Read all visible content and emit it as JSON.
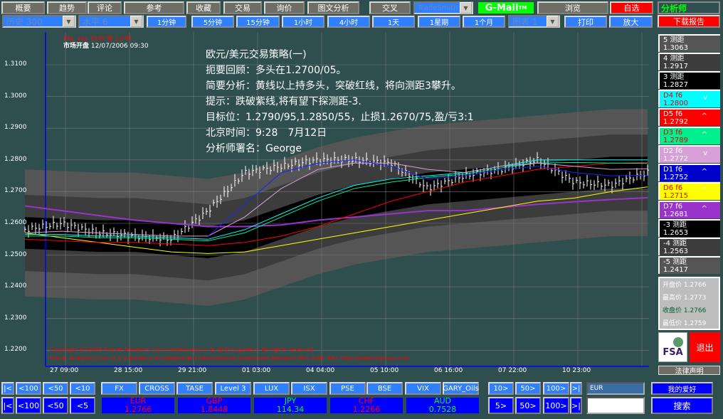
{
  "topbar": [
    "概要",
    "趋势",
    "评论",
    "参考",
    "收藏",
    "交易",
    "询价",
    "图文分析",
    "交叉"
  ],
  "tradesmith": "TradeSmith",
  "gmail": "G-Mail",
  "gmail_tm": "TM",
  "browse": "浏览",
  "custom": "自选",
  "analyst": "分析师",
  "history_select": "历史 300",
  "level_select": "水平 6",
  "periods": [
    "1分钟",
    "5分钟",
    "15分钟",
    "1小时",
    "4小时",
    "1天",
    "1星期",
    "1个月"
  ],
  "chart_select": "图表 1",
  "print": "打印",
  "zoom": "放大",
  "download": "下载报告",
  "chart_header": {
    "title": "PAL_Hu: EUR 线 1小时",
    "open_label": "市场开盘",
    "open_time": "12/07/2006 09:30"
  },
  "overlay": [
    "欧元/美元交易策略(一)",
    "扼要回顾：多头在1.2700/05。",
    "简要分析：黄线以上持多头，突破红线，将向测距3攀升。",
    "提示：跌破紫线,将有望下探测距-3.",
    "目标位：1.2790/95,1.2850/55，止损1.2670/75,盈/亏3:1",
    "北京时间：9:28　7月12日",
    "分析师署名：George"
  ],
  "copyright": [
    "Copyright (C)2003 Fronet Analytics.com Limited and or its data suppliers.  All rights reserved.",
    "Frone: Analytics.com is a subsidiary of Independent International Investment Research PLC (LSE: IIR), http://www.iirgroup.com"
  ],
  "levels": [
    {
      "label": "5 测距",
      "value": "1.3063",
      "bg": "#555555",
      "fg": "#ffffff",
      "chev": ""
    },
    {
      "label": "4 测距",
      "value": "1.2917",
      "bg": "#3c3c3c",
      "fg": "#ffffff",
      "chev": ""
    },
    {
      "label": "3 测距",
      "value": "1.2827",
      "bg": "#000000",
      "fg": "#ffffff",
      "chev": ""
    },
    {
      "label": "D4  f6",
      "value": "1.2800",
      "bg": "#00ffff",
      "fg": "#e00000",
      "chev": "v"
    },
    {
      "label": "D5  f6",
      "value": "1.2792",
      "bg": "#ff0000",
      "fg": "#ffffff",
      "chev": "^"
    },
    {
      "label": "D3  f6",
      "value": "1.2789",
      "bg": "#00f090",
      "fg": "#e00000",
      "chev": "^"
    },
    {
      "label": "D2  f6",
      "value": "1.2772",
      "bg": "#d8a0d8",
      "fg": "#ffffff",
      "chev": "v"
    },
    {
      "label": "D1  f6",
      "value": "1.2752",
      "bg": "#0000cc",
      "fg": "#ffffff",
      "chev": "^"
    },
    {
      "label": "D6  f6",
      "value": "1.2715",
      "bg": "#ffff00",
      "fg": "#e00000",
      "chev": "^"
    },
    {
      "label": "D7  f6",
      "value": "1.2681",
      "bg": "#9933cc",
      "fg": "#ffffff",
      "chev": "^"
    },
    {
      "label": "-3 测距",
      "value": "1.2653",
      "bg": "#000000",
      "fg": "#ffffff",
      "chev": ""
    },
    {
      "label": "-4 测距",
      "value": "1.2563",
      "bg": "#3c3c3c",
      "fg": "#ffffff",
      "chev": ""
    },
    {
      "label": "-5 测距",
      "value": "1.2417",
      "bg": "#555555",
      "fg": "#ffffff",
      "chev": ""
    }
  ],
  "ohlc": [
    {
      "label": "开盘价 1.2766",
      "color": "#ffffff"
    },
    {
      "label": "最高价 1.2773",
      "color": "#ffffff"
    },
    {
      "label": "收盘价 1.2766",
      "color": "#006030"
    },
    {
      "label": "最低价 1.2759",
      "color": "#ffffff"
    }
  ],
  "fsa": "FSA",
  "exit": "退出",
  "legal": "法律声明",
  "nav_left1": [
    "|<",
    "<100",
    "<50",
    "<10"
  ],
  "nav_left2": [
    "|<",
    "<100",
    "<50",
    "<5"
  ],
  "markets": [
    "FX",
    "CROSS",
    "TASE",
    "Level 3",
    "LUX",
    "ISX",
    "PSE",
    "BSE",
    "VIX",
    "GARY_Oils"
  ],
  "quotes": [
    {
      "cur": "EUR",
      "val": "1.2766",
      "color": "#ff0000"
    },
    {
      "cur": "GBP",
      "val": "1.8448",
      "color": "#ff0000"
    },
    {
      "cur": "JPY",
      "val": "114.34",
      "color": "#00ff00"
    },
    {
      "cur": "CHF",
      "val": "1.2266",
      "color": "#ff0000"
    },
    {
      "cur": "AUD",
      "val": "0.7528",
      "color": "#00ff00"
    }
  ],
  "nav_right1": [
    "10>",
    "50>",
    "100>",
    ">|"
  ],
  "nav_right2": [
    "5>",
    "50>",
    "100>",
    ">|"
  ],
  "symbol_input": "EUR",
  "search_input": "",
  "favorites": "我的爱好",
  "search": "搜索",
  "chart_data": {
    "type": "line",
    "yticks": [
      "1.3100",
      "1.3000",
      "1.2900",
      "1.2800",
      "1.2700",
      "1.2600",
      "1.2500",
      "1.2400",
      "1.2300",
      "1.2200"
    ],
    "ylim": [
      1.22,
      1.31
    ],
    "xticks": [
      "27 09:00",
      "28 15:00",
      "29 21:00",
      "01 03:00",
      "04 04:00",
      "05 10:00",
      "06 16:00",
      "07 22:00",
      "10 23:00"
    ],
    "price": [
      1.258,
      1.26,
      1.257,
      1.256,
      1.255,
      1.264,
      1.276,
      1.278,
      1.28,
      1.28,
      1.279,
      1.271,
      1.275,
      1.277,
      1.28,
      1.273,
      1.272,
      1.276
    ],
    "band_center": [
      1.257,
      1.2565,
      1.256,
      1.256,
      1.255,
      1.254,
      1.256,
      1.26,
      1.264,
      1.267,
      1.269,
      1.271,
      1.272,
      1.273,
      1.274,
      1.275,
      1.276,
      1.276
    ],
    "band_widths": [
      0.02,
      0.012,
      0.005
    ],
    "series": [
      {
        "name": "D7",
        "color": "#9933cc",
        "values": [
          1.2655,
          1.264,
          1.2625,
          1.261,
          1.26,
          1.259,
          1.259,
          1.2595,
          1.261,
          1.262,
          1.263,
          1.264,
          1.264,
          1.265,
          1.266,
          1.2668,
          1.2675,
          1.2681
        ]
      },
      {
        "name": "D6",
        "color": "#ffff00",
        "values": [
          1.257,
          1.2555,
          1.254,
          1.2525,
          1.251,
          1.2505,
          1.251,
          1.253,
          1.255,
          1.257,
          1.259,
          1.261,
          1.263,
          1.265,
          1.267,
          1.268,
          1.27,
          1.2715
        ]
      },
      {
        "name": "D5",
        "color": "#ff0000",
        "values": [
          1.255,
          1.2545,
          1.254,
          1.254,
          1.2535,
          1.253,
          1.254,
          1.256,
          1.259,
          1.263,
          1.267,
          1.27,
          1.273,
          1.275,
          1.277,
          1.278,
          1.279,
          1.2792
        ]
      },
      {
        "name": "D3",
        "color": "#00f090",
        "values": [
          1.256,
          1.256,
          1.2555,
          1.2555,
          1.255,
          1.2545,
          1.257,
          1.262,
          1.267,
          1.271,
          1.273,
          1.2745,
          1.2755,
          1.2775,
          1.279,
          1.2792,
          1.279,
          1.2789
        ]
      },
      {
        "name": "D4",
        "color": "#00ffff",
        "values": [
          1.2565,
          1.2565,
          1.256,
          1.256,
          1.2555,
          1.255,
          1.258,
          1.263,
          1.268,
          1.272,
          1.274,
          1.275,
          1.276,
          1.278,
          1.28,
          1.28,
          1.28,
          1.28
        ]
      },
      {
        "name": "D2",
        "color": "#d8a0d8",
        "values": [
          1.257,
          1.2575,
          1.257,
          1.2565,
          1.256,
          1.256,
          1.262,
          1.271,
          1.277,
          1.279,
          1.279,
          1.277,
          1.276,
          1.278,
          1.279,
          1.278,
          1.277,
          1.2772
        ]
      },
      {
        "name": "D1",
        "color": "#2020ff",
        "values": [
          null,
          null,
          null,
          null,
          null,
          1.256,
          1.266,
          1.276,
          1.279,
          1.28,
          1.278,
          1.274,
          1.275,
          1.277,
          1.278,
          1.276,
          1.275,
          1.2752
        ]
      }
    ]
  }
}
